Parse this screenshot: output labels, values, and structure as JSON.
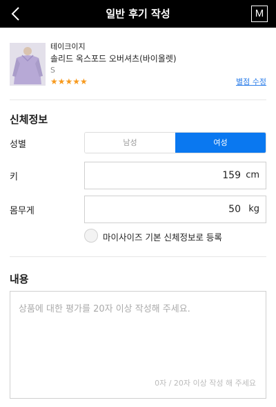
{
  "header": {
    "title": "일반 후기 작성",
    "logo_letter": "M"
  },
  "product": {
    "brand": "테이크이지",
    "name": "솔리드 옥스포드 오버셔츠(바이올렛)",
    "option": "S",
    "rating": 5,
    "stars": "★★★★★",
    "star_color": "#f79a1e",
    "edit_label": "별점 수정"
  },
  "body_info": {
    "title": "신체정보",
    "gender_label": "성별",
    "gender_options": [
      "남성",
      "여성"
    ],
    "gender_selected": "여성",
    "height_label": "키",
    "height_value": "159",
    "height_unit": "cm",
    "weight_label": "몸무게",
    "weight_value": "50",
    "weight_unit": "kg",
    "save_label": "마이사이즈 기본 신체정보로 등록"
  },
  "content": {
    "title": "내용",
    "placeholder": "상품에 대한 평가를 20자 이상 작성해 주세요.",
    "counter": "0자 / 20자 이상 작성 해 주세요"
  },
  "colors": {
    "accent": "#0a78f0",
    "link": "#2b7de9",
    "header_bg": "#000000"
  }
}
